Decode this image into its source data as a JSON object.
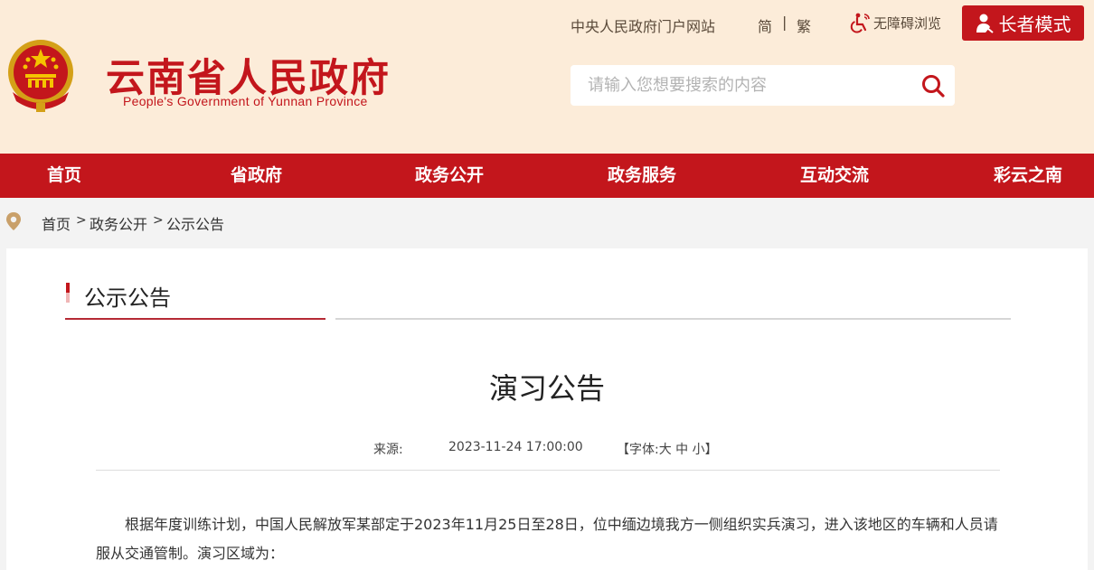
{
  "header": {
    "title": "云南省人民政府",
    "subtitle": "People's Government of Yunnan Province",
    "central_gov_link": "中央人民政府门户网站",
    "lang_simplified": "简",
    "lang_separator": "|",
    "lang_traditional": "繁",
    "accessibility_label": "无障碍浏览",
    "elder_mode_label": "长者模式",
    "search_placeholder": "请输入您想要搜索的内容"
  },
  "nav": {
    "items": [
      "首页",
      "省政府",
      "政务公开",
      "政务服务",
      "互动交流",
      "彩云之南"
    ]
  },
  "breadcrumb": {
    "items": [
      "首页",
      "政务公开",
      "公示公告"
    ],
    "separator": ">"
  },
  "section": {
    "title": "公示公告"
  },
  "article": {
    "title": "演习公告",
    "source_label": "来源:",
    "date": "2023-11-24 17:00:00",
    "font_size_prefix": "【字体:",
    "font_large": "大",
    "font_medium": "中",
    "font_small": "小",
    "font_size_suffix": "】",
    "body": "根据年度训练计划，中国人民解放军某部定于2023年11月25日至28日，位中缅边境我方一侧组织实兵演习，进入该地区的车辆和人员请服从交通管制。演习区域为："
  },
  "colors": {
    "brand_red": "#c3161c",
    "header_bg": "#fcecd9",
    "page_bg": "#f3f3f3"
  },
  "icons": [
    "national-emblem-icon",
    "accessibility-icon",
    "elder-person-icon",
    "search-icon",
    "location-pin-icon"
  ]
}
